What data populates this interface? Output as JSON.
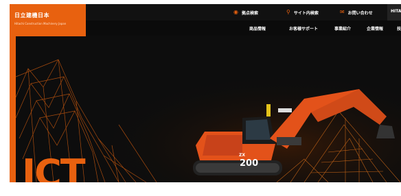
{
  "header": {
    "logo_name": "日立建機日本",
    "logo_sub": "Hitachi Construction Machinery Japan",
    "utility": [
      {
        "label": "拠点検索",
        "icon": "person-pin-icon"
      },
      {
        "label": "サイト内検索",
        "icon": "search-icon"
      },
      {
        "label": "お問い合わせ",
        "icon": "mail-icon"
      }
    ],
    "brand_tab": "HITA"
  },
  "nav": {
    "items": [
      "商品情報",
      "お客様サポート",
      "事業紹介",
      "企業情報",
      "技"
    ]
  },
  "hero": {
    "headline": "ICT",
    "machine_model": "200",
    "machine_brand": "ZX"
  },
  "colors": {
    "accent": "#e8610f",
    "background": "#0d0d0d"
  }
}
